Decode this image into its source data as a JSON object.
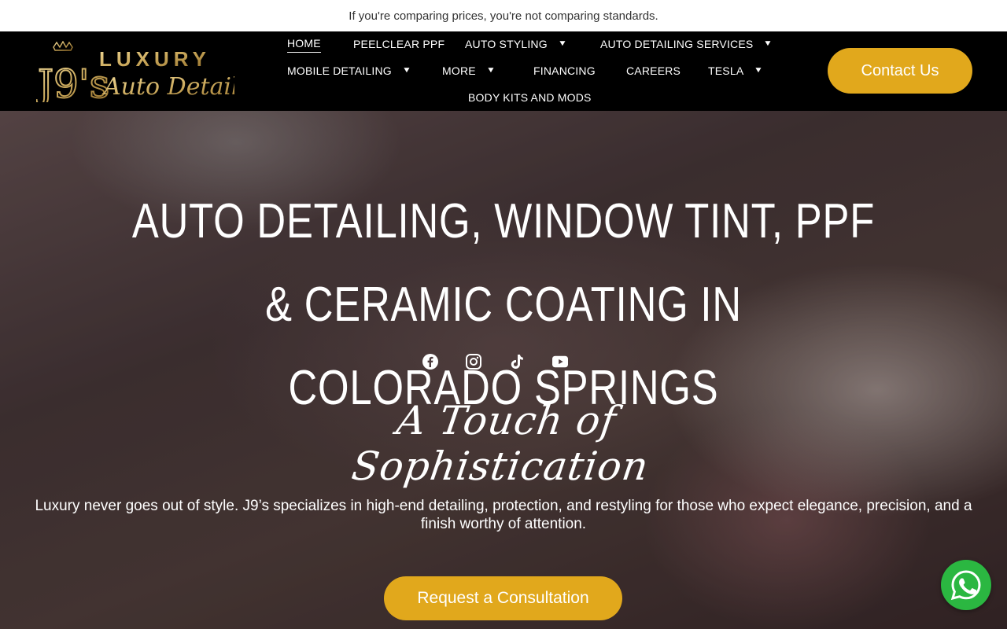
{
  "announcement": "If you're comparing prices, you're not comparing standards.",
  "logo": {
    "monogram": "J9's",
    "word1": "LUXURY",
    "word2": "Auto Detailing"
  },
  "nav": {
    "items": [
      {
        "label": "HOME",
        "active": true,
        "dropdown": false
      },
      {
        "label": "PEELCLEAR PPF",
        "dropdown": false
      },
      {
        "label": "AUTO STYLING",
        "dropdown": true
      },
      {
        "label": "AUTO DETAILING SERVICES",
        "dropdown": true
      },
      {
        "label": "MOBILE DETAILING",
        "dropdown": true
      },
      {
        "label": "MORE",
        "dropdown": true
      },
      {
        "label": "FINANCING",
        "dropdown": false
      },
      {
        "label": "CAREERS",
        "dropdown": false
      },
      {
        "label": "TESLA",
        "dropdown": true
      },
      {
        "label": "BODY KITS AND MODS",
        "dropdown": false
      }
    ],
    "caret": "▼"
  },
  "header_cta": "Contact Us",
  "hero": {
    "title_line1": "Auto Detailing,  Window Tint, PPF & Ceramic Coating in",
    "title_line2": "Colorado Springs",
    "socials": [
      "facebook-icon",
      "instagram-icon",
      "tiktok-icon",
      "youtube-icon"
    ],
    "tagline": "A Touch of Sophistication",
    "lede": "Luxury never goes out of style. J9’s specializes in high-end detailing, protection, and restyling for those who expect elegance, precision, and a finish worthy of attention.",
    "cta": "Request a Consultation"
  },
  "colors": {
    "accent": "#e1a81c",
    "header_bg": "#000000",
    "gold": "#c9a75a",
    "whatsapp": "#2bb741"
  }
}
